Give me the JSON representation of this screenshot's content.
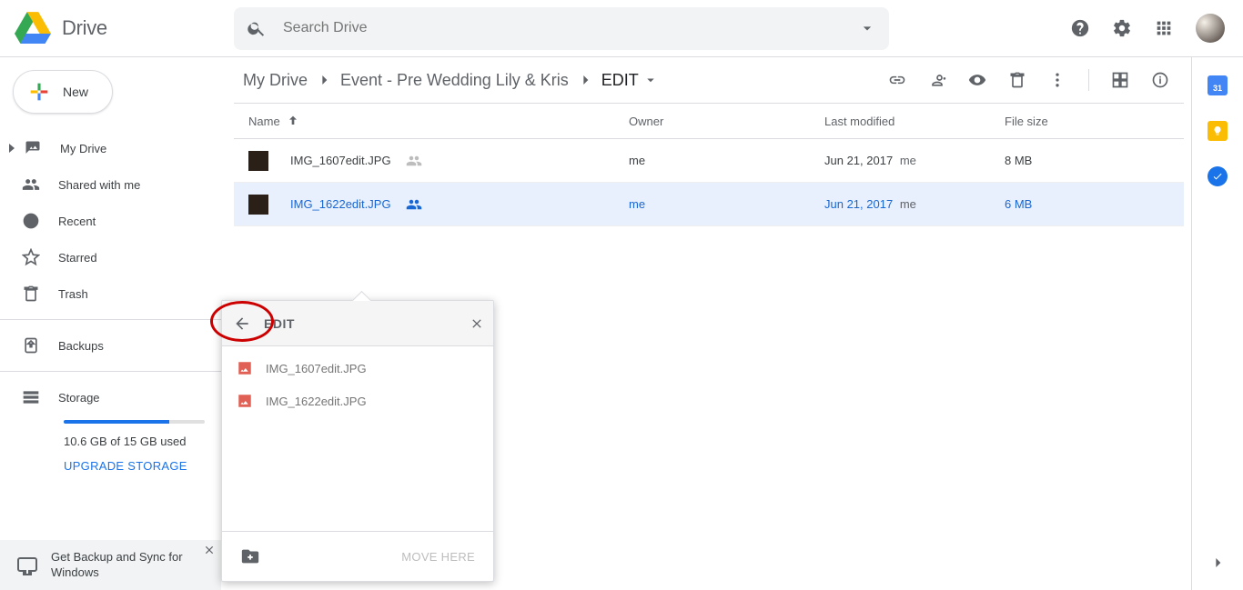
{
  "app": {
    "name": "Drive"
  },
  "search": {
    "placeholder": "Search Drive"
  },
  "sidebar": {
    "new_label": "New",
    "items": [
      {
        "label": "My Drive"
      },
      {
        "label": "Shared with me"
      },
      {
        "label": "Recent"
      },
      {
        "label": "Starred"
      },
      {
        "label": "Trash"
      }
    ],
    "backups_label": "Backups",
    "storage_label": "Storage",
    "storage_text": "10.6 GB of 15 GB used",
    "upgrade_label": "UPGRADE STORAGE"
  },
  "promo": {
    "text": "Get Backup and Sync for Windows"
  },
  "breadcrumbs": [
    {
      "label": "My Drive"
    },
    {
      "label": "Event - Pre Wedding Lily & Kris"
    },
    {
      "label": "EDIT"
    }
  ],
  "columns": {
    "name": "Name",
    "owner": "Owner",
    "modified": "Last modified",
    "size": "File size"
  },
  "files": [
    {
      "name": "IMG_1607edit.JPG",
      "owner": "me",
      "modified_date": "Jun 21, 2017",
      "modified_by": "me",
      "size": "8 MB",
      "selected": false
    },
    {
      "name": "IMG_1622edit.JPG",
      "owner": "me",
      "modified_date": "Jun 21, 2017",
      "modified_by": "me",
      "size": "6 MB",
      "selected": true
    }
  ],
  "move_popover": {
    "title": "EDIT",
    "items": [
      {
        "name": "IMG_1607edit.JPG"
      },
      {
        "name": "IMG_1622edit.JPG"
      }
    ],
    "move_label": "MOVE HERE"
  },
  "rail": {
    "calendar_day": "31"
  }
}
